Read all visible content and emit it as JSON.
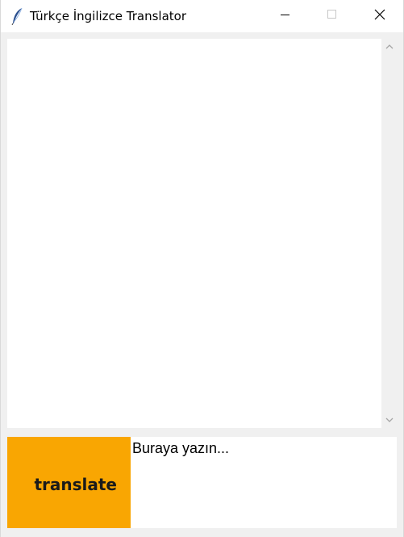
{
  "window": {
    "title": "Türkçe İngilizce Translator",
    "app_icon": "feather-icon",
    "controls": {
      "minimize_icon": "minimize-icon",
      "maximize_icon": "maximize-icon",
      "close_icon": "close-icon"
    }
  },
  "output": {
    "text": ""
  },
  "scrollbar": {
    "up_icon": "chevron-up-icon",
    "down_icon": "chevron-down-icon"
  },
  "translate_button": {
    "label": "translate",
    "color": "#f9a602"
  },
  "input": {
    "text": "Buraya yazın..."
  }
}
